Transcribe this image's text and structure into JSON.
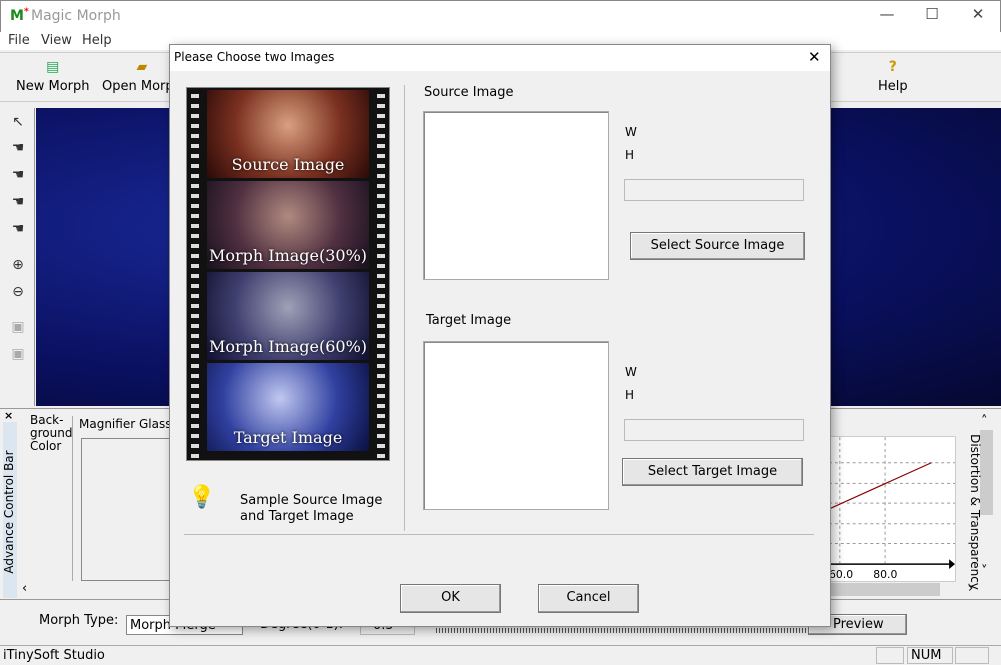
{
  "app": {
    "title": "Magic Morph",
    "logo": "M",
    "window_controls": [
      "minimize",
      "maximize",
      "close"
    ]
  },
  "menu": [
    "File",
    "View",
    "Help"
  ],
  "toolbar": {
    "new_morph": "New Morph",
    "open_morph": "Open Morph",
    "help": "Help"
  },
  "left_tools": [
    "pointer-icon",
    "hand-add-icon",
    "hand-move-icon",
    "hand-remove-icon",
    "hand-curve-icon",
    "zoom-in-icon",
    "zoom-out-icon",
    "tool-disabled-1-icon",
    "tool-disabled-2-icon"
  ],
  "panel": {
    "close": "×",
    "side_label": "Advance Control Bar",
    "background_color": "Back-\nground\nColor",
    "magnifier": "Magnifier Glass",
    "distortion_label": "Distortion & Transparency",
    "x_ticks": [
      "60.0",
      "80.0"
    ],
    "line_color": "#8b0000"
  },
  "controls": {
    "morph_type_label": "Morph Type:",
    "morph_type_value": "Morph Merge",
    "degree_label": "Degree(0-1):",
    "degree_value": "0.5",
    "preview": "Preview"
  },
  "status": {
    "text": "iTinySoft Studio",
    "num": "NUM"
  },
  "dialog": {
    "title": "Please Choose two Images",
    "frames": [
      "Source Image",
      "Morph Image(30%)",
      "Morph Image(60%)",
      "Target Image"
    ],
    "sample_text": "Sample Source Image and Target Image",
    "source": {
      "label": "Source Image",
      "w": "W",
      "h": "H",
      "button": "Select Source Image"
    },
    "target": {
      "label": "Target Image",
      "w": "W",
      "h": "H",
      "button": "Select Target Image"
    },
    "ok": "OK",
    "cancel": "Cancel"
  }
}
